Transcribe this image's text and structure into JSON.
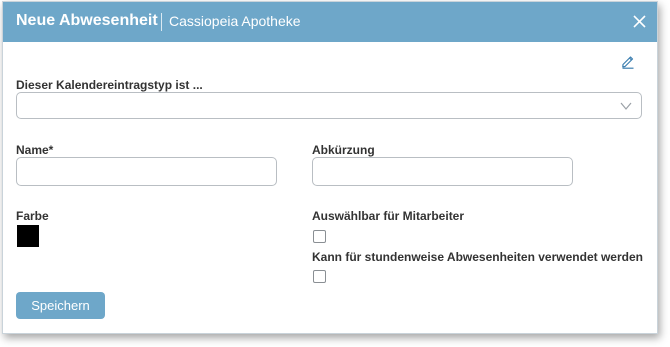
{
  "dialog": {
    "title": "Neue Abwesenheit",
    "subtitle": "Cassiopeia Apotheke",
    "header_color": "#6ea7c9"
  },
  "form": {
    "type_label": "Dieser Kalendereintragstyp ist ...",
    "type_value": "",
    "name_label": "Name*",
    "name_value": "",
    "abbr_label": "Abkürzung",
    "abbr_value": "",
    "color_label": "Farbe",
    "color_value": "#000000",
    "selectable_label": "Auswählbar für Mitarbeiter",
    "selectable_checked": false,
    "hourly_label": "Kann für stundenweise Abwesenheiten verwendet werden",
    "hourly_checked": false
  },
  "actions": {
    "save_label": "Speichern"
  },
  "icons": {
    "close": "close-icon",
    "edit": "pencil-icon",
    "dropdown": "chevron-down-icon"
  }
}
